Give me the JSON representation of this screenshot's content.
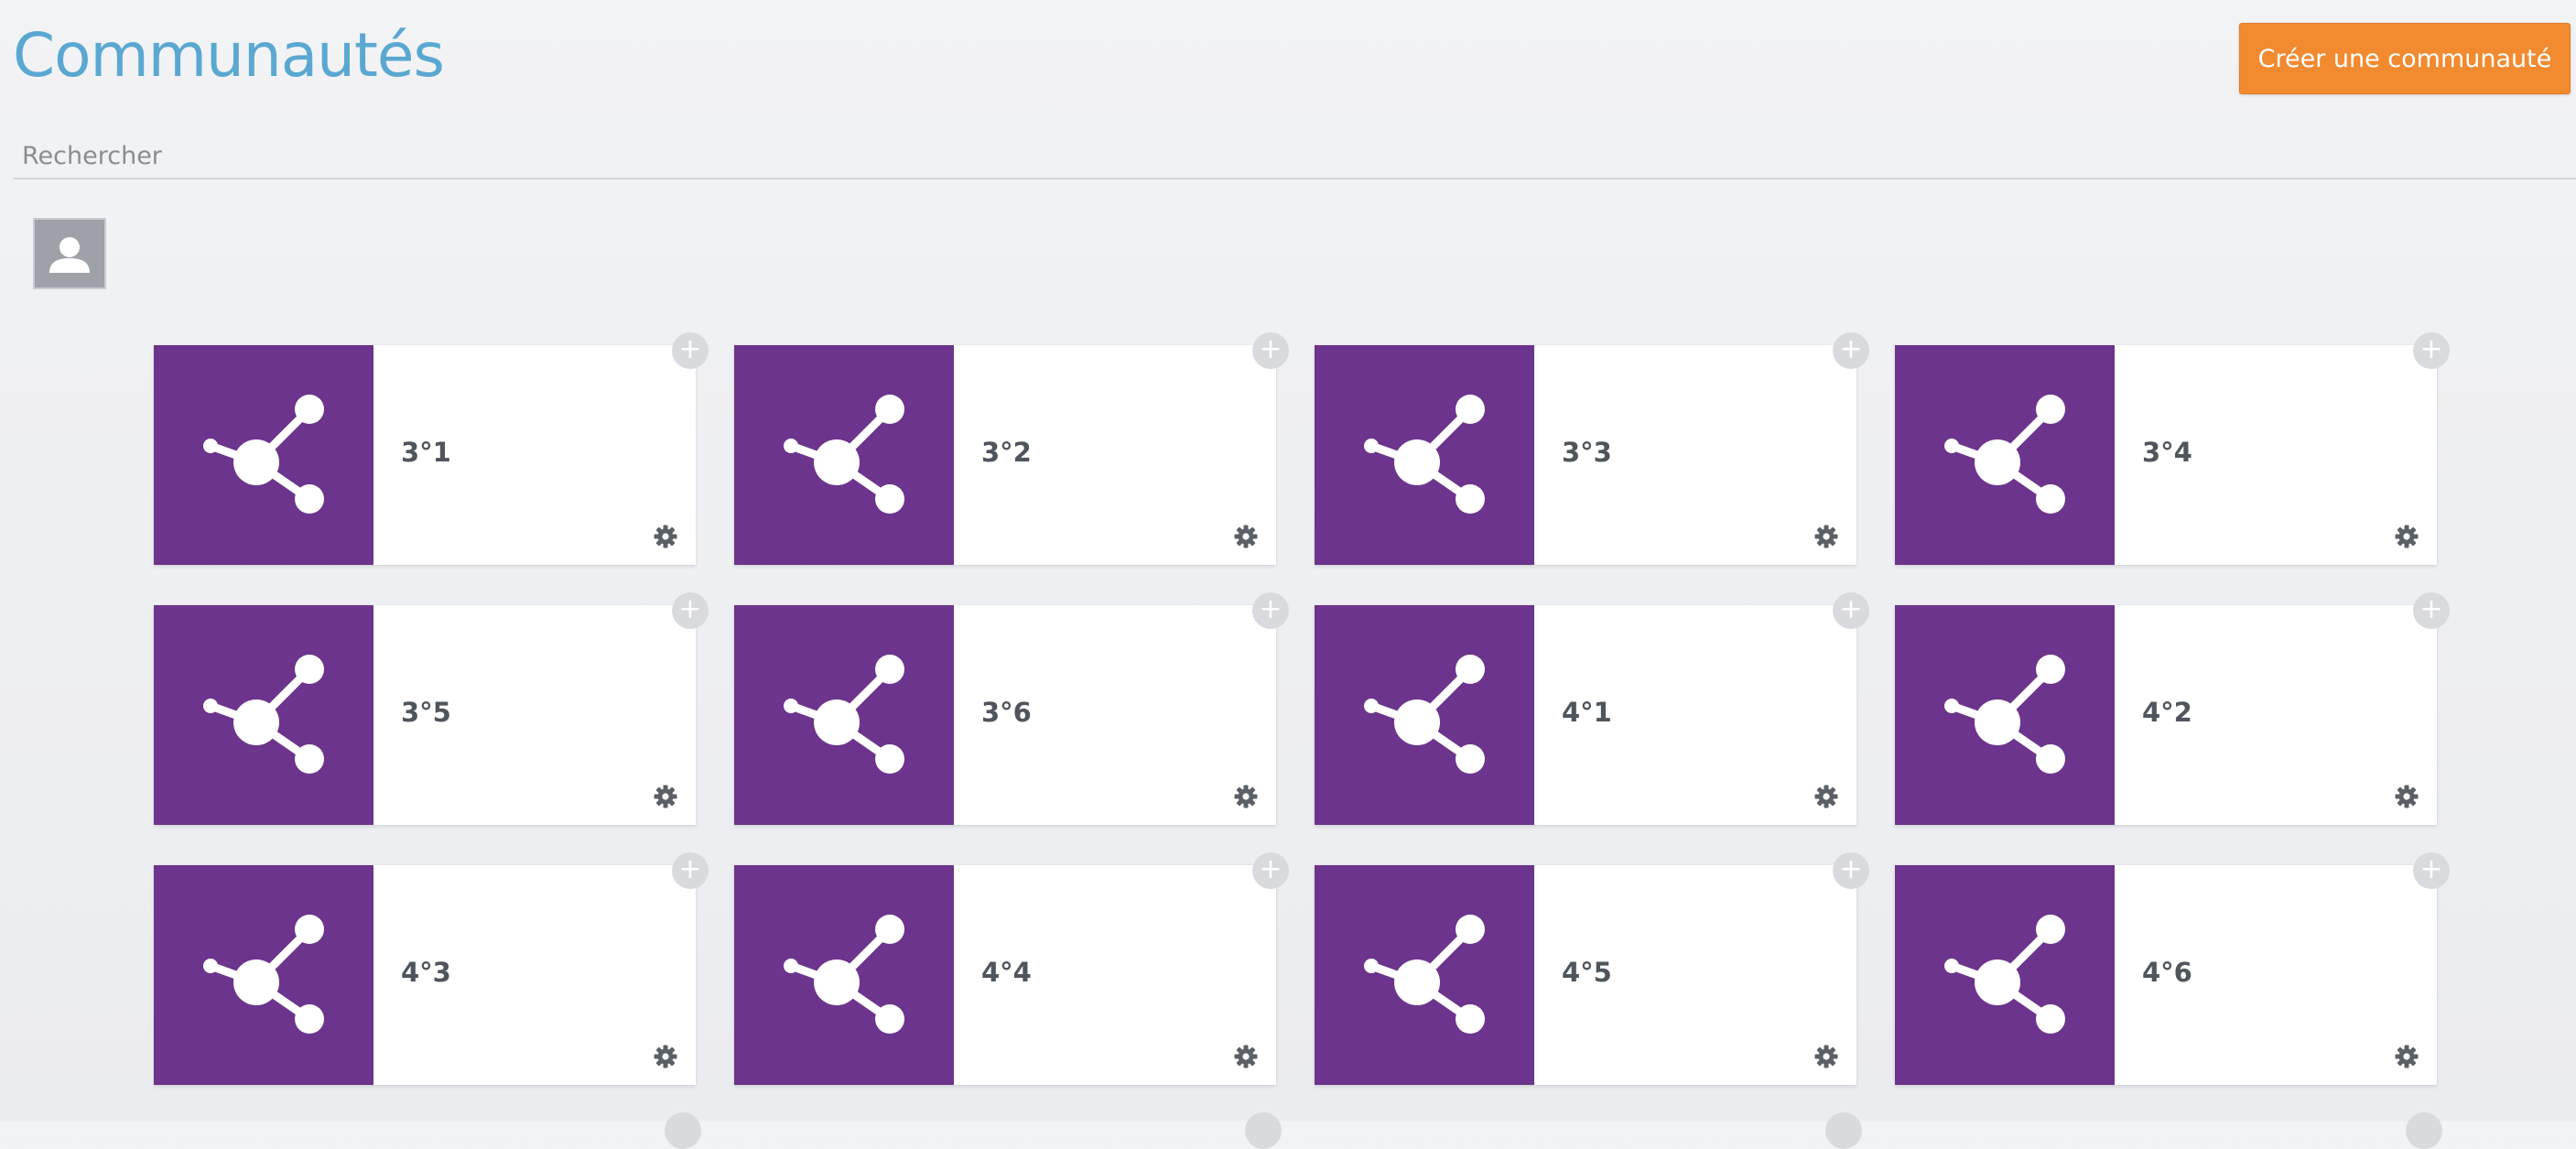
{
  "header": {
    "title": "Communautés",
    "create_button_label": "Créer une communauté"
  },
  "search": {
    "placeholder": "Rechercher",
    "value": ""
  },
  "colors": {
    "title": "#5aa8d2",
    "create_button": "#f28a30",
    "card_thumbnail": "#6c348c",
    "card_label": "#4f555c"
  },
  "communities": [
    {
      "name": "3°1",
      "icon": "share-icon"
    },
    {
      "name": "3°2",
      "icon": "share-icon"
    },
    {
      "name": "3°3",
      "icon": "share-icon"
    },
    {
      "name": "3°4",
      "icon": "share-icon"
    },
    {
      "name": "3°5",
      "icon": "share-icon"
    },
    {
      "name": "3°6",
      "icon": "share-icon"
    },
    {
      "name": "4°1",
      "icon": "share-icon"
    },
    {
      "name": "4°2",
      "icon": "share-icon"
    },
    {
      "name": "4°3",
      "icon": "share-icon"
    },
    {
      "name": "4°4",
      "icon": "share-icon"
    },
    {
      "name": "4°5",
      "icon": "share-icon"
    },
    {
      "name": "4°6",
      "icon": "share-icon"
    }
  ],
  "card_actions": {
    "add_icon": "plus-icon",
    "add_symbol": "+",
    "settings_icon": "gear-icon"
  }
}
